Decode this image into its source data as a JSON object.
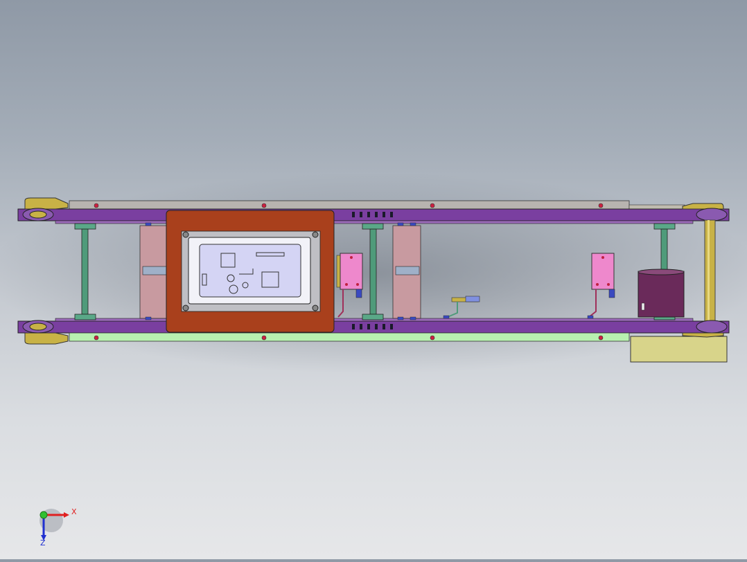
{
  "viewport": {
    "model": "conveyor-assembly",
    "view": "top",
    "background": "gradient-gray"
  },
  "triad": {
    "x_label": "X",
    "z_label": "Z",
    "x_color": "#e02020",
    "z_color": "#2030d0",
    "origin_color": "#30c030"
  },
  "colors": {
    "frame_purple": "#7a3fa0",
    "bearing_gold": "#c8b246",
    "hmi_panel": "#a9401c",
    "screen_lavender": "#d4d4f4",
    "green_rail": "#b8f0b0",
    "support_green": "#4f9b7a",
    "valve_pink": "#ee88cc",
    "motor_box": "#d8d48a",
    "plate_pink": "#c89aa0"
  }
}
